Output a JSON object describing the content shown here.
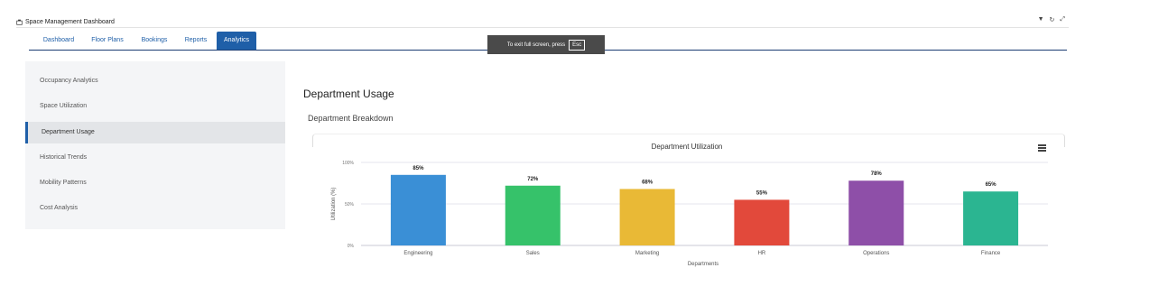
{
  "window": {
    "title": "Space Management Dashboard"
  },
  "nav": {
    "tabs": [
      {
        "label": "Dashboard"
      },
      {
        "label": "Floor Plans"
      },
      {
        "label": "Bookings"
      },
      {
        "label": "Reports"
      },
      {
        "label": "Analytics"
      }
    ],
    "active_tab": "Analytics"
  },
  "toast": {
    "text": "To exit full screen, press",
    "key": "Esc"
  },
  "sidebar": {
    "items": [
      {
        "label": "Occupancy Analytics"
      },
      {
        "label": "Space Utilization"
      },
      {
        "label": "Department Usage"
      },
      {
        "label": "Historical Trends"
      },
      {
        "label": "Mobility Patterns"
      },
      {
        "label": "Cost Analysis"
      }
    ],
    "active_item": "Department Usage"
  },
  "main": {
    "title": "Department Usage",
    "section_title": "Department Breakdown"
  },
  "chart_data": {
    "type": "bar",
    "title": "Department Utilization",
    "xlabel": "Departments",
    "ylabel": "Utilization (%)",
    "categories": [
      "Engineering",
      "Sales",
      "Marketing",
      "HR",
      "Operations",
      "Finance"
    ],
    "values": [
      85,
      72,
      68,
      55,
      78,
      65
    ],
    "value_labels": [
      "85%",
      "72%",
      "68%",
      "55%",
      "78%",
      "65%"
    ],
    "colors": [
      "#3a8fd6",
      "#36c26a",
      "#e9b936",
      "#e2493b",
      "#8e4fa8",
      "#2bb591"
    ],
    "ylim": [
      0,
      100
    ],
    "yticks": [
      "0%",
      "50%",
      "100%"
    ],
    "grid": true
  }
}
